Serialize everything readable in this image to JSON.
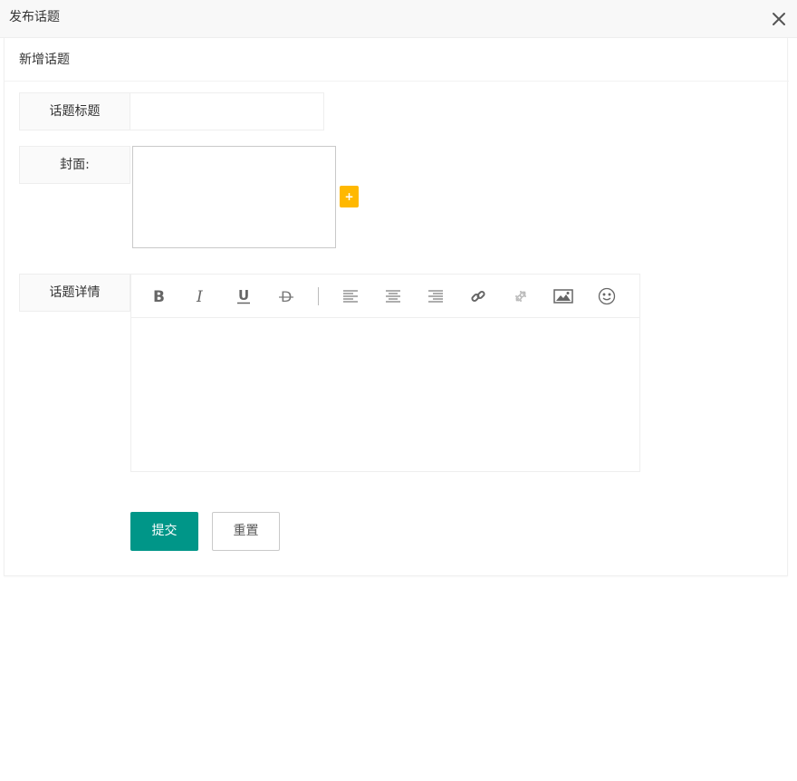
{
  "dialog": {
    "title": "发布话题"
  },
  "card": {
    "header": "新增话题"
  },
  "form": {
    "title_label": "话题标题",
    "title_value": "",
    "cover_label": "封面:",
    "cover_add": "+",
    "details_label": "话题详情",
    "details_value": ""
  },
  "editor": {
    "tools": [
      "bold-icon",
      "italic-icon",
      "underline-icon",
      "strikethrough-icon",
      "align-left-icon",
      "align-center-icon",
      "align-right-icon",
      "link-icon",
      "unlink-icon",
      "image-icon",
      "emoji-icon"
    ]
  },
  "buttons": {
    "submit": "提交",
    "reset": "重置"
  },
  "colors": {
    "primary": "#009688",
    "warning": "#ffb800"
  }
}
